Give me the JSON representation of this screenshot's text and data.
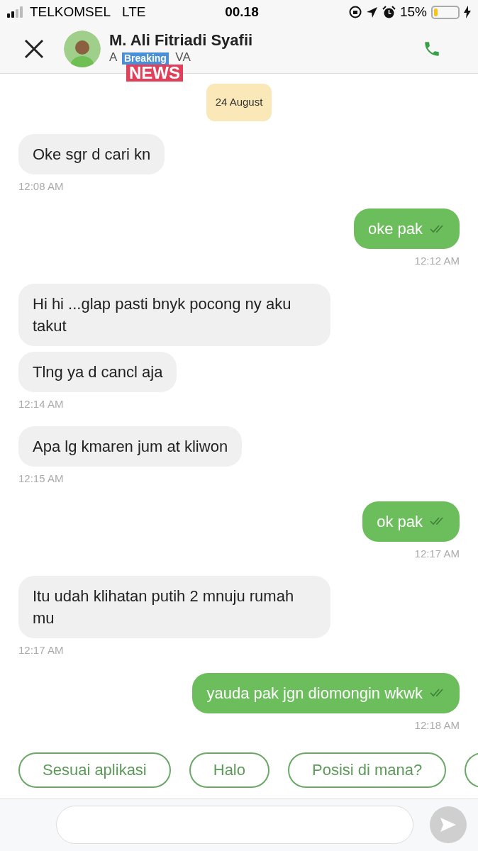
{
  "status_bar": {
    "carrier": "TELKOMSEL",
    "network": "LTE",
    "time": "00.18",
    "battery": "15%"
  },
  "header": {
    "name": "M. Ali Fitriadi Syafii",
    "subtitle_start": "A",
    "subtitle_end": "VA",
    "sticker": {
      "top": "Breaking",
      "bottom": "NEWS"
    }
  },
  "date": "24 August",
  "messages": [
    {
      "kind": "incoming",
      "text": "Oke sgr d cari kn",
      "time": "12:08 AM"
    },
    {
      "kind": "outgoing",
      "text": "oke pak",
      "read": true,
      "time": "12:12 AM"
    },
    {
      "kind": "incoming",
      "text": "Hi hi ...glap pasti bnyk pocong ny aku takut"
    },
    {
      "kind": "incoming",
      "text": "Tlng ya d cancl aja",
      "time": "12:14 AM"
    },
    {
      "kind": "incoming",
      "text": "Apa lg kmaren jum at kliwon",
      "time": "12:15 AM"
    },
    {
      "kind": "outgoing",
      "text": "ok pak",
      "read": true,
      "time": "12:17 AM"
    },
    {
      "kind": "incoming",
      "text": "Itu udah klihatan putih 2 mnuju rumah mu",
      "time": "12:17 AM"
    },
    {
      "kind": "outgoing",
      "text": "yauda pak jgn diomongin wkwk",
      "read": true,
      "time": "12:18 AM"
    }
  ],
  "quick_replies": [
    "Sesuai aplikasi",
    "Halo",
    "Posisi di mana?"
  ]
}
